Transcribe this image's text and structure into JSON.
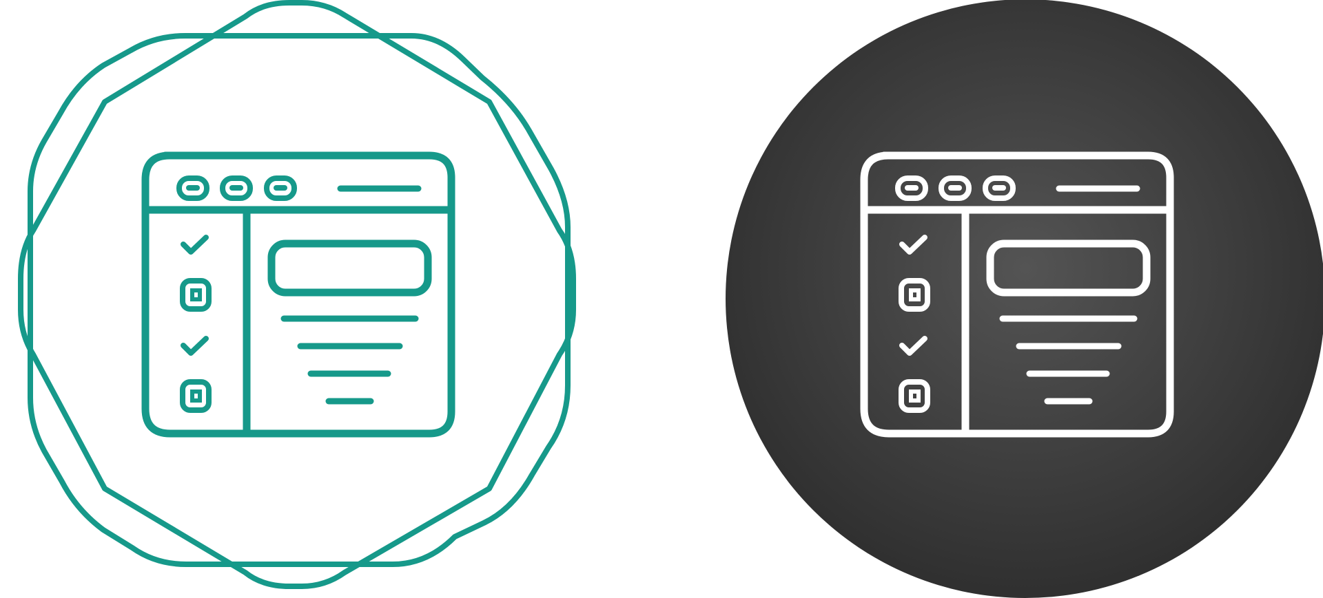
{
  "icons": [
    {
      "name": "task-manager-window-icon-outline",
      "variant": "outline",
      "stroke_color": "#16998a",
      "background": "none",
      "frame": "octagon-badge",
      "window": {
        "title_bar_buttons": 3,
        "sidebar_items": [
          {
            "kind": "checkmark"
          },
          {
            "kind": "checkbox"
          },
          {
            "kind": "checkmark"
          },
          {
            "kind": "checkbox"
          }
        ],
        "content_lines": 4
      }
    },
    {
      "name": "task-manager-window-icon-glyph",
      "variant": "glyph-on-dark-circle",
      "stroke_color": "#ffffff",
      "background_gradient": [
        "#545454",
        "#2c2c2c"
      ],
      "frame": "circle",
      "window": {
        "title_bar_buttons": 3,
        "sidebar_items": [
          {
            "kind": "checkmark"
          },
          {
            "kind": "checkbox"
          },
          {
            "kind": "checkmark"
          },
          {
            "kind": "checkbox"
          }
        ],
        "content_lines": 4
      }
    }
  ]
}
